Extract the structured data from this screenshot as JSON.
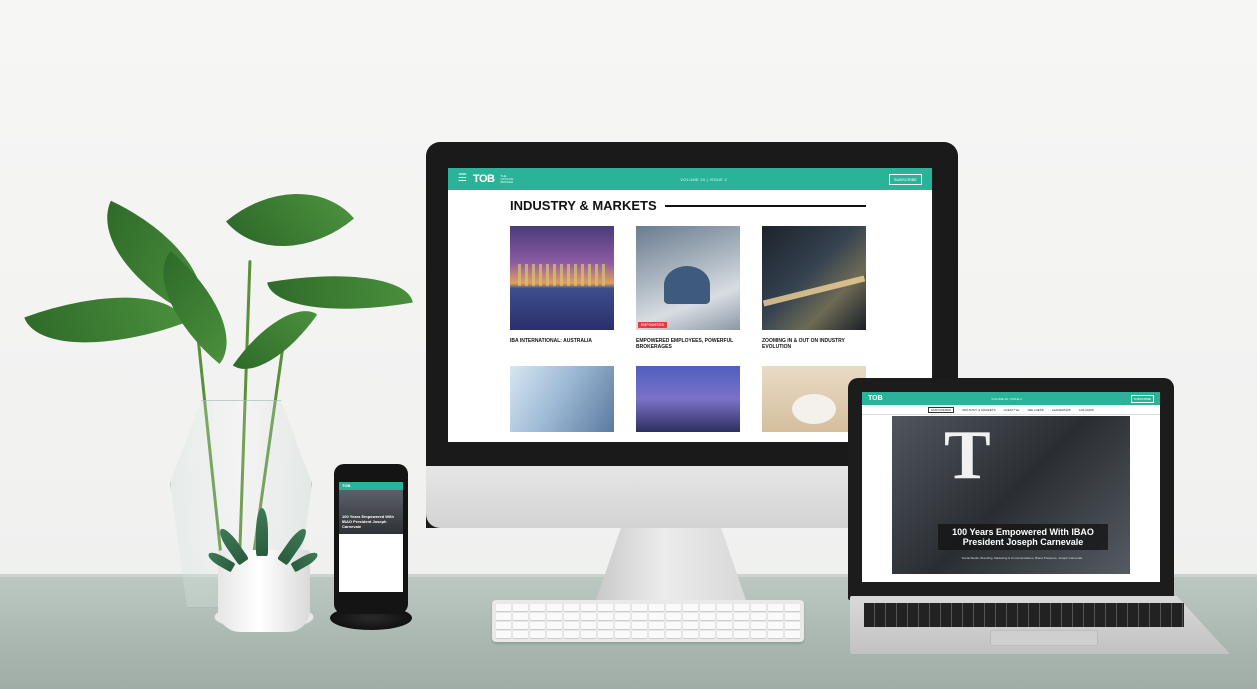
{
  "imac": {
    "header": {
      "menu_icon": "hamburger-icon",
      "logo": "TOB",
      "logo_sub": "THE OFFICIAL BROKER",
      "volume": "VOLUME 20 | ISSUE 2",
      "subscribe": "SUBSCRIBE"
    },
    "section_title": "INDUSTRY & MARKETS",
    "articles": [
      {
        "title": "IBA INTERNATIONAL: AUSTRALIA",
        "badge": ""
      },
      {
        "title": "EMPOWERED EMPLOYEES, POWERFUL BROKERAGES",
        "badge": "EMPOWERED"
      },
      {
        "title": "ZOOMING IN & OUT ON INDUSTRY EVOLUTION",
        "badge": ""
      },
      {
        "title": "",
        "badge": ""
      },
      {
        "title": "",
        "badge": ""
      },
      {
        "title": "",
        "badge": ""
      }
    ]
  },
  "laptop": {
    "header": {
      "logo": "TOB",
      "volume": "VOLUME 20 | ISSUE 2",
      "subscribe": "SUBSCRIBE"
    },
    "nav": [
      "EMPOWERED",
      "INDUSTRY & MARKETS",
      "LIFESTYLE",
      "WELLNESS",
      "LEADERSHIP",
      "COLUMNS"
    ],
    "hero_title": "100 Years Empowered With IBAO President Joseph Carnevale",
    "hero_subtitle": "Social Media, Branding, Marketing & Communications, Brand Presence, Joseph Carnevale"
  },
  "phone": {
    "logo": "TOB",
    "hero_title": "100 Years Empowered With IBAO President Joseph Carnevale"
  }
}
